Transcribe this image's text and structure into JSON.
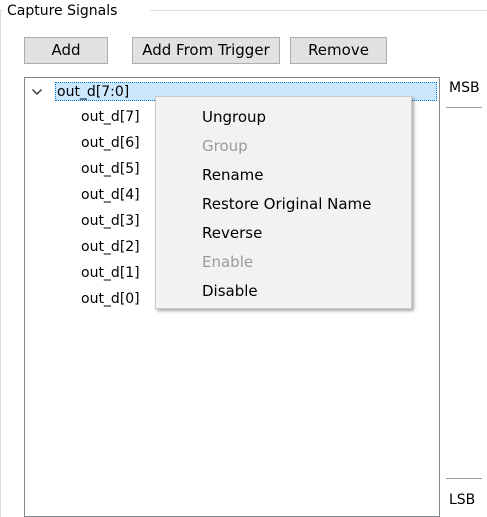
{
  "groupbox": {
    "title": "Capture Signals"
  },
  "toolbar": {
    "add_label": "Add",
    "add_from_trigger_label": "Add From Trigger",
    "remove_label": "Remove"
  },
  "tree": {
    "parent": {
      "label": "out_d[7:0]",
      "expanded": true,
      "selected": true
    },
    "children": [
      {
        "label": "out_d[7]"
      },
      {
        "label": "out_d[6]"
      },
      {
        "label": "out_d[5]"
      },
      {
        "label": "out_d[4]"
      },
      {
        "label": "out_d[3]"
      },
      {
        "label": "out_d[2]"
      },
      {
        "label": "out_d[1]"
      },
      {
        "label": "out_d[0]"
      }
    ]
  },
  "side_labels": {
    "msb": "MSB",
    "lsb": "LSB"
  },
  "context_menu": {
    "items": [
      {
        "label": "Ungroup",
        "enabled": true
      },
      {
        "label": "Group",
        "enabled": false
      },
      {
        "label": "Rename",
        "enabled": true
      },
      {
        "label": "Restore Original Name",
        "enabled": true
      },
      {
        "label": "Reverse",
        "enabled": true
      },
      {
        "label": "Enable",
        "enabled": false
      },
      {
        "label": "Disable",
        "enabled": true
      }
    ]
  },
  "colors": {
    "selection_bg": "#cce8ff",
    "selection_border": "#0078d7",
    "disabled_text": "#9a9a9a",
    "button_bg": "#e1e1e1"
  },
  "icons": {
    "expand": "chevron-down-icon"
  }
}
